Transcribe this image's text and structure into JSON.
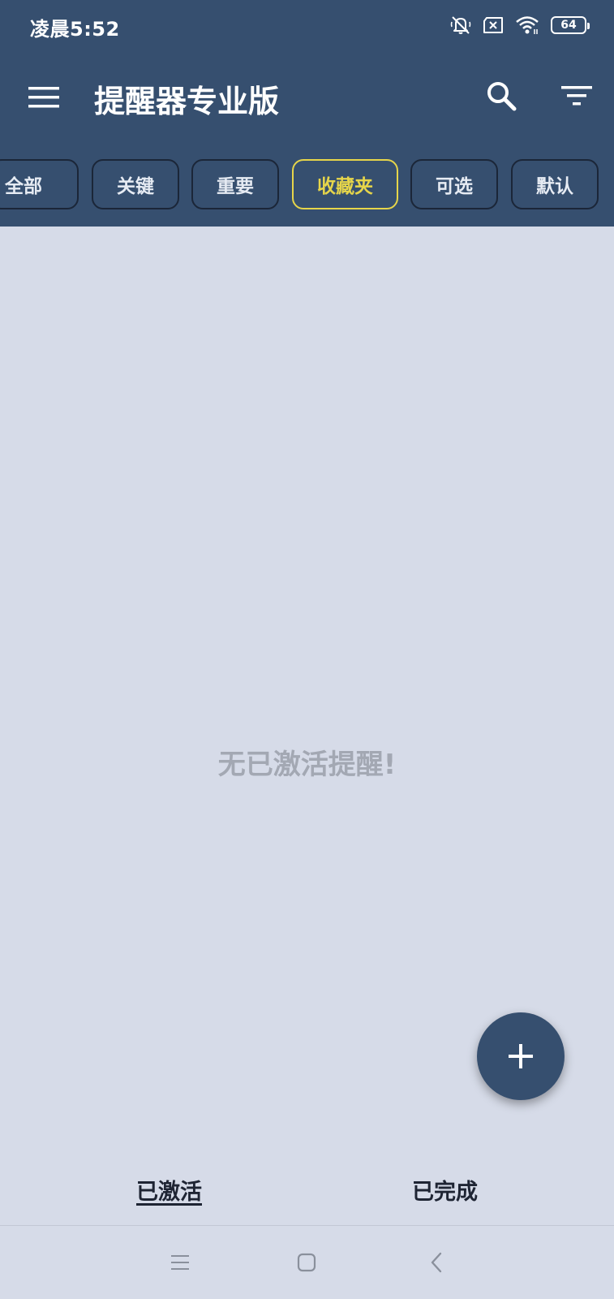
{
  "status_bar": {
    "time": "凌晨5:52",
    "battery_level": "64",
    "icons": [
      "bell-off-icon",
      "sim-error-icon",
      "wifi-icon",
      "battery-icon"
    ]
  },
  "app_bar": {
    "title": "提醒器专业版",
    "menu_icon": "menu-icon",
    "search_icon": "search-icon",
    "filter_icon": "filter-icon"
  },
  "filter_chips": {
    "items": [
      {
        "label": "全部",
        "selected": false
      },
      {
        "label": "关键",
        "selected": false
      },
      {
        "label": "重要",
        "selected": false
      },
      {
        "label": "收藏夹",
        "selected": true
      },
      {
        "label": "可选",
        "selected": false
      },
      {
        "label": "默认",
        "selected": false
      }
    ]
  },
  "content": {
    "empty_message": "无已激活提醒!"
  },
  "fab": {
    "icon": "plus-icon"
  },
  "bottom_tabs": {
    "active_label": "已激活",
    "done_label": "已完成",
    "selected": "已激活"
  },
  "system_nav": {
    "icons": [
      "recents-icon",
      "home-icon",
      "back-icon"
    ]
  },
  "colors": {
    "header_bg": "#364f6f",
    "page_bg": "#d6dbe8",
    "chip_selected": "#e6d54a",
    "empty_text": "#a3a8b3"
  }
}
